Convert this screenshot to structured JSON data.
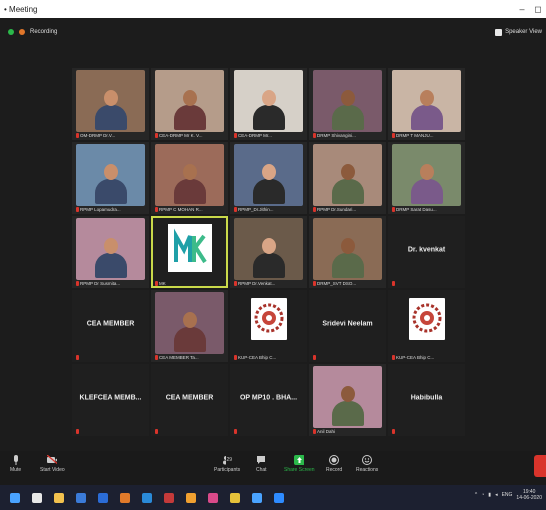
{
  "window": {
    "title": "• Meeting",
    "min": "–",
    "max": "◻"
  },
  "meeting_bar": {
    "recording_label": "Recording",
    "speaker_view_label": "Speaker View"
  },
  "tiles": [
    {
      "name": "OM-DRMP Dr.V...",
      "kind": "video",
      "active": false
    },
    {
      "name": "CEA-DRMP Mr K. V...",
      "kind": "video",
      "active": false
    },
    {
      "name": "CEA-DRMP Mr...",
      "kind": "video",
      "active": false
    },
    {
      "name": "DRMP Shivangini...",
      "kind": "video",
      "active": false
    },
    {
      "name": "DRMP T MANJU...",
      "kind": "video",
      "active": false
    },
    {
      "name": "RPMP Lopamudra...",
      "kind": "video",
      "active": false
    },
    {
      "name": "RPMP C MOHAN R...",
      "kind": "video",
      "active": false
    },
    {
      "name": "RPMP_Dr.Jithin...",
      "kind": "video",
      "active": false
    },
    {
      "name": "RPMP Dr.Sundari...",
      "kind": "video",
      "active": false
    },
    {
      "name": "DRMP Sarat Dasu...",
      "kind": "video",
      "active": false
    },
    {
      "name": "RPMP Dr Susmita...",
      "kind": "video",
      "active": false
    },
    {
      "name": "MK",
      "kind": "logo-mk",
      "active": true
    },
    {
      "name": "RPMP Dr.Venkat...",
      "kind": "video",
      "active": false
    },
    {
      "name": "DRMP_SVT DSO...",
      "kind": "video",
      "active": false
    },
    {
      "name": "Dr. kvenkat",
      "kind": "text",
      "active": false
    },
    {
      "name": "CEA MEMBER",
      "kind": "text",
      "active": false
    },
    {
      "name": "CEA MEMBER Ta...",
      "kind": "video",
      "active": false
    },
    {
      "name": "KUP-CEA Bhip C...",
      "kind": "logo",
      "active": false
    },
    {
      "name": "Sridevi Neelam",
      "kind": "text",
      "active": false
    },
    {
      "name": "KUP-CEA Bhip C...",
      "kind": "logo",
      "active": false
    },
    {
      "name": "KLEFCEA  MEMB...",
      "kind": "text",
      "active": false
    },
    {
      "name": "CEA MEMBER",
      "kind": "text",
      "active": false
    },
    {
      "name": "OP MP10 . BHA...",
      "kind": "text",
      "active": false
    },
    {
      "name": "Anil Dahi",
      "kind": "video",
      "active": false
    },
    {
      "name": "Habibulla",
      "kind": "text",
      "active": false
    }
  ],
  "controls": {
    "mute": "Mute",
    "start_video": "Start Video",
    "participants": "Participants",
    "participants_count": "29",
    "chat": "Chat",
    "share_screen": "Share Screen",
    "record": "Record",
    "reactions": "Reactions"
  },
  "taskbar": {
    "time": "19:40",
    "date": "14-06-2020",
    "lang": "ENG"
  },
  "colors": {
    "active_border": "#c9d94a",
    "mic_off": "#d9342b",
    "share_green": "#2bb84a",
    "end_red": "#d9342b"
  }
}
